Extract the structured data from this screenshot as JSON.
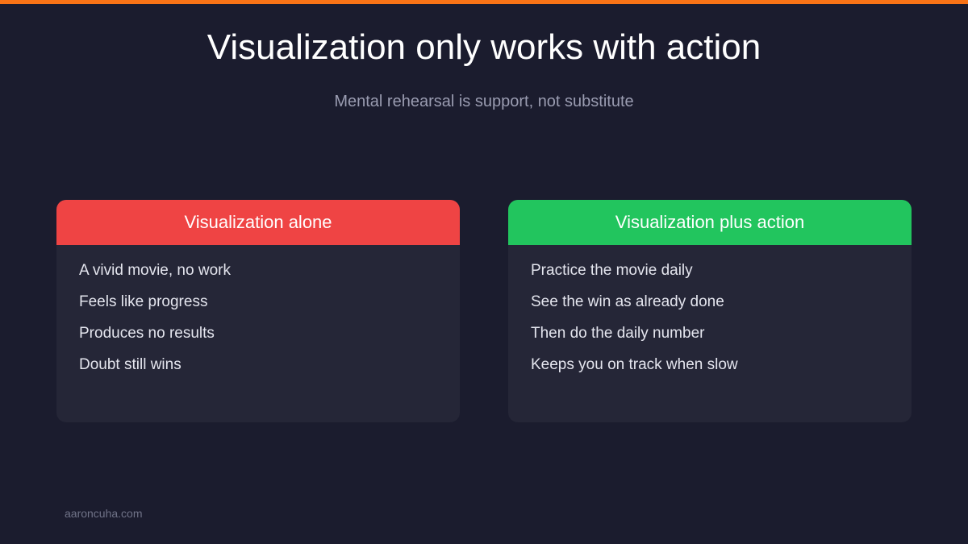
{
  "accent_color": "#f97316",
  "title": "Visualization only works with action",
  "subtitle": "Mental rehearsal is support, not substitute",
  "left_card": {
    "header": "Visualization alone",
    "header_color": "#ef4444",
    "items": [
      "A vivid movie, no work",
      "Feels like progress",
      "Produces no results",
      "Doubt still wins"
    ]
  },
  "right_card": {
    "header": "Visualization plus action",
    "header_color": "#22c55e",
    "items": [
      "Practice the movie daily",
      "See the win as already done",
      "Then do the daily number",
      "Keeps you on track when slow"
    ]
  },
  "footer": "aaroncuha.com"
}
